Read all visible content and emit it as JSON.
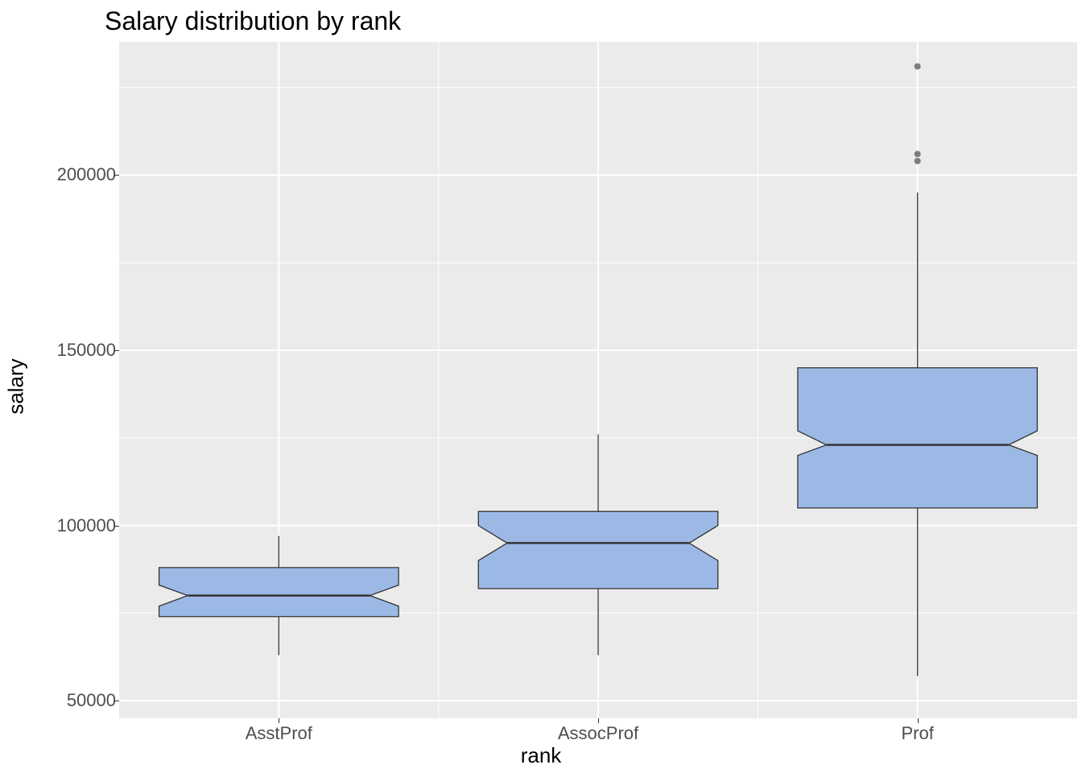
{
  "chart_data": {
    "type": "boxplot",
    "title": "Salary distribution by rank",
    "xlabel": "rank",
    "ylabel": "salary",
    "categories": [
      "AsstProf",
      "AssocProf",
      "Prof"
    ],
    "y_ticks": [
      50000,
      100000,
      150000,
      200000
    ],
    "ylim": [
      45000,
      238000
    ],
    "notched": true,
    "fill": "#9cb9e6",
    "stroke": "#333333",
    "series": [
      {
        "name": "AsstProf",
        "min": 63000,
        "q1": 74000,
        "median": 80000,
        "q3": 88000,
        "max": 97000,
        "notch_lo": 77000,
        "notch_hi": 83000,
        "outliers": []
      },
      {
        "name": "AssocProf",
        "min": 63000,
        "q1": 82000,
        "median": 95000,
        "q3": 104000,
        "max": 126000,
        "notch_lo": 90000,
        "notch_hi": 100000,
        "outliers": []
      },
      {
        "name": "Prof",
        "min": 57000,
        "q1": 105000,
        "median": 123000,
        "q3": 145000,
        "max": 195000,
        "notch_lo": 120000,
        "notch_hi": 127000,
        "outliers": [
          204000,
          206000,
          231000
        ]
      }
    ]
  }
}
